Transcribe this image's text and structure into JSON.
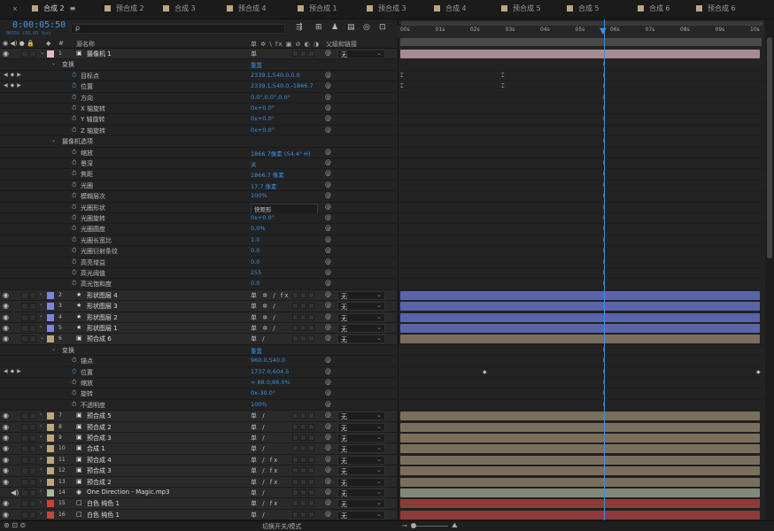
{
  "tabs": [
    {
      "label": "合成 2",
      "active": true,
      "menu": "≡"
    },
    {
      "label": "预合成 2"
    },
    {
      "label": "合成 3"
    },
    {
      "label": "预合成 4"
    },
    {
      "label": "预合成 1"
    },
    {
      "label": "预合成 3"
    },
    {
      "label": "合成 4"
    },
    {
      "label": "预合成 5"
    },
    {
      "label": "合成 5"
    },
    {
      "label": "合成 6"
    },
    {
      "label": "预合成 6"
    }
  ],
  "timecode": "0:00:05:50",
  "fps_info": "00350 (60.00 fps)",
  "search_icon": "ρ",
  "columns": {
    "source_name": "源名称",
    "switches": "单 ✲ \\ fx ▣ ⊘ ◐ ◑",
    "parent": "父级和链接"
  },
  "ruler_ticks": [
    "00s",
    "01s",
    "02s",
    "03s",
    "04s",
    "05s",
    "06s",
    "07s",
    "08s",
    "09s",
    "10s"
  ],
  "rows": [
    {
      "type": "layer",
      "num": "1",
      "name": "摄像机 1",
      "color": "#e6b9c6",
      "icon": "▣",
      "switch": "单",
      "parent": "无",
      "bar": "#a88a93",
      "expanded": true
    },
    {
      "type": "group",
      "name": "变换",
      "value": "重置",
      "indent": 1
    },
    {
      "type": "prop",
      "name": "目标点",
      "value": "2339.1,540.0,0.0",
      "indent": 2,
      "kfnav": true,
      "stopwatch": "on"
    },
    {
      "type": "prop",
      "name": "位置",
      "value": "2339.1,540.0,-1866.7",
      "indent": 2,
      "kfnav": true,
      "stopwatch": "on"
    },
    {
      "type": "prop",
      "name": "方向",
      "value": "0.0°,0.0°,0.0°",
      "indent": 2
    },
    {
      "type": "prop",
      "name": "X 轴旋转",
      "value": "0x+0.0°",
      "indent": 2
    },
    {
      "type": "prop",
      "name": "Y 轴旋转",
      "value": "0x+0.0°",
      "indent": 2
    },
    {
      "type": "prop",
      "name": "Z 轴旋转",
      "value": "0x+0.0°",
      "indent": 2
    },
    {
      "type": "group",
      "name": "摄像机选项",
      "value": "",
      "indent": 1
    },
    {
      "type": "prop",
      "name": "缩放",
      "value": "1866.7像素 (54.4° H)",
      "indent": 2
    },
    {
      "type": "prop",
      "name": "景深",
      "value": "关",
      "indent": 2
    },
    {
      "type": "prop",
      "name": "焦距",
      "value": "1866.7 像素",
      "indent": 2
    },
    {
      "type": "prop",
      "name": "光圈",
      "value": "17.7 像素",
      "indent": 2
    },
    {
      "type": "prop",
      "name": "模糊层次",
      "value": "100%",
      "indent": 2
    },
    {
      "type": "prop",
      "name": "光圈形状",
      "value": "快矩形",
      "indent": 2,
      "dropdown": true
    },
    {
      "type": "prop",
      "name": "光圈旋转",
      "value": "0x+0.0°",
      "indent": 2
    },
    {
      "type": "prop",
      "name": "光圈圆度",
      "value": "0.0%",
      "indent": 2
    },
    {
      "type": "prop",
      "name": "光圈长宽比",
      "value": "1.0",
      "indent": 2
    },
    {
      "type": "prop",
      "name": "光圈衍射条纹",
      "value": "0.0",
      "indent": 2
    },
    {
      "type": "prop",
      "name": "高亮增益",
      "value": "0.0",
      "indent": 2
    },
    {
      "type": "prop",
      "name": "高光阈值",
      "value": "255",
      "indent": 2
    },
    {
      "type": "prop",
      "name": "高光饱和度",
      "value": "0.0",
      "indent": 2
    },
    {
      "type": "layer",
      "num": "2",
      "name": "形状图层 4",
      "color": "#7d86d6",
      "icon": "★",
      "switch": "单 ✲ / fx",
      "parent": "无",
      "bar": "#5a64a8"
    },
    {
      "type": "layer",
      "num": "3",
      "name": "形状图层 3",
      "color": "#7d86d6",
      "icon": "★",
      "switch": "单 ✲ /",
      "parent": "无",
      "bar": "#5a64a8"
    },
    {
      "type": "layer",
      "num": "4",
      "name": "形状图层 2",
      "color": "#7d86d6",
      "icon": "★",
      "switch": "单 ✲ /",
      "parent": "无",
      "bar": "#5a64a8"
    },
    {
      "type": "layer",
      "num": "5",
      "name": "形状图层 1",
      "color": "#7d86d6",
      "icon": "★",
      "switch": "单 ✲ /",
      "parent": "无",
      "bar": "#5a64a8"
    },
    {
      "type": "layer",
      "num": "6",
      "name": "预合成 6",
      "color": "#bda77f",
      "icon": "▣",
      "switch": "单 /",
      "parent": "无",
      "bar": "#7a6f5c",
      "expanded": true
    },
    {
      "type": "group",
      "name": "变换",
      "value": "重置",
      "indent": 1
    },
    {
      "type": "prop",
      "name": "锚点",
      "value": "960.0,540.0",
      "indent": 2
    },
    {
      "type": "prop",
      "name": "位置",
      "value": "1737.0,604.5",
      "indent": 2,
      "kfnav": true,
      "stopwatch": "on"
    },
    {
      "type": "prop",
      "name": "缩放",
      "value": "∞ 88.0,88.0%",
      "indent": 2
    },
    {
      "type": "prop",
      "name": "旋转",
      "value": "0x-30.0°",
      "indent": 2
    },
    {
      "type": "prop",
      "name": "不透明度",
      "value": "100%",
      "indent": 2
    },
    {
      "type": "layer",
      "num": "7",
      "name": "预合成 5",
      "color": "#bda77f",
      "icon": "▣",
      "switch": "单 /",
      "parent": "无",
      "bar": "#7a6f5c"
    },
    {
      "type": "layer",
      "num": "8",
      "name": "预合成 2",
      "color": "#bda77f",
      "icon": "▣",
      "switch": "单 /",
      "parent": "无",
      "bar": "#7a6f5c"
    },
    {
      "type": "layer",
      "num": "9",
      "name": "预合成 3",
      "color": "#bda77f",
      "icon": "▣",
      "switch": "单 /",
      "parent": "无",
      "bar": "#7a6f5c"
    },
    {
      "type": "layer",
      "num": "10",
      "name": "合成 1",
      "color": "#bda77f",
      "icon": "▣",
      "switch": "单 /",
      "parent": "无",
      "bar": "#7a6f5c"
    },
    {
      "type": "layer",
      "num": "11",
      "name": "预合成 4",
      "color": "#bda77f",
      "icon": "▣",
      "switch": "单 / fx",
      "parent": "无",
      "bar": "#7a6f5c"
    },
    {
      "type": "layer",
      "num": "12",
      "name": "预合成 3",
      "color": "#bda77f",
      "icon": "▣",
      "switch": "单 / fx",
      "parent": "无",
      "bar": "#7a6f5c"
    },
    {
      "type": "layer",
      "num": "13",
      "name": "预合成 2",
      "color": "#bda77f",
      "icon": "▣",
      "switch": "单 / fx",
      "parent": "无",
      "bar": "#7a6f5c"
    },
    {
      "type": "layer",
      "num": "14",
      "name": "One Direction - Magic.mp3",
      "color": "#a9b9a2",
      "icon": "◉",
      "switch": "单 /",
      "parent": "无",
      "bar": "#7f8a7b",
      "audio": true
    },
    {
      "type": "layer",
      "num": "15",
      "name": "白色 纯色 1",
      "color": "#c8433e",
      "icon": "□",
      "switch": "单 / fx",
      "parent": "无",
      "bar": "#8e3a3a"
    },
    {
      "type": "layer",
      "num": "16",
      "name": "白色 纯色 1",
      "color": "#c8433e",
      "icon": "□",
      "switch": "单 /",
      "parent": "无",
      "bar": "#8e3a3a"
    }
  ],
  "bottom": {
    "mode_label": "切换开关/模式"
  }
}
